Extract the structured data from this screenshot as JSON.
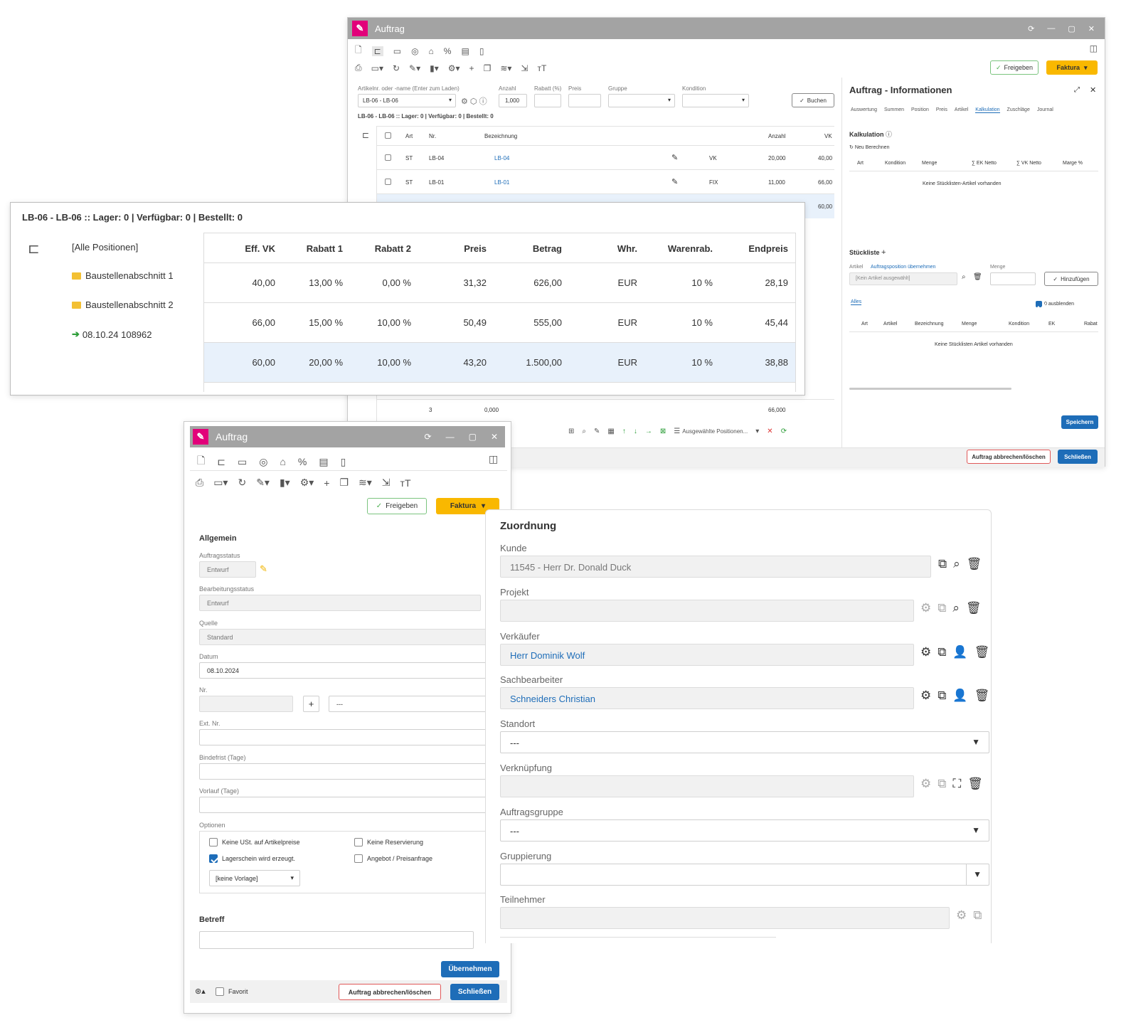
{
  "back_window": {
    "title": "Auftrag",
    "top_buttons": {
      "freigeben": "Freigeben",
      "faktura": "Faktura"
    },
    "article_field_label": "Artikelnr. oder -name (Enter zum Laden)",
    "article_value": "LB-06 - LB-06",
    "anzahl_label": "Anzahl",
    "anzahl_value": "1,000",
    "rabatt_label": "Rabatt (%)",
    "preis_label": "Preis",
    "gruppe_label": "Gruppe",
    "kondition_label": "Kondition",
    "buchen_label": "Buchen",
    "stock_line": "LB-06 - LB-06 :: Lager: 0 | Verfügbar: 0 | Bestellt: 0",
    "columns": [
      "Art",
      "Nr.",
      "Bezeichnung",
      "Anzahl",
      "VK"
    ],
    "rows": [
      {
        "art": "ST",
        "nr": "LB-04",
        "bez": "LB-04",
        "kond": "VK",
        "anzahl": "20,000",
        "vk": "40,00"
      },
      {
        "art": "ST",
        "nr": "LB-01",
        "bez": "LB-01",
        "kond": "FIX",
        "anzahl": "11,000",
        "vk": "66,00"
      },
      {
        "vk": "60,00"
      }
    ],
    "footer": {
      "count": "3",
      "anzahl": "0,000",
      "vk": "66,000"
    },
    "selected_positions": "Ausgewählte Positionen...",
    "bottom_buttons": {
      "cancel": "Auftrag abbrechen/löschen",
      "close": "Schließen"
    },
    "info_panel": {
      "title": "Auftrag - Informationen",
      "tabs": [
        "Auswertung",
        "Summen",
        "Position",
        "Preis",
        "Artikel",
        "Kalkulation",
        "Zuschläge",
        "Journal"
      ],
      "active_tab": "Kalkulation",
      "kalk_title": "Kalkulation",
      "recalc": "Neu Berechnen",
      "kalk_columns": [
        "Art",
        "Kondition",
        "Menge",
        "∑ EK Netto",
        "∑ VK Netto",
        "Marge %"
      ],
      "kalk_empty": "Keine Stücklisten-Artikel vorhanden",
      "stueckliste_title": "Stückliste",
      "artikel_label": "Artikel",
      "auftragsposition_link": "Auftragsposition übernehmen",
      "artikel_placeholder": "[Kein Artikel ausgewählt]",
      "menge_label": "Menge",
      "hinzufuegen": "Hinzufügen",
      "alles_tab": "Alles",
      "ausblenden": "0 ausblenden",
      "sl_columns": [
        "Art",
        "Artikel",
        "Bezeichnung",
        "Menge",
        "Kondition",
        "EK",
        "Rabat"
      ],
      "sl_empty": "Keine Stücklisten Artikel vorhanden",
      "speichern": "Speichern"
    }
  },
  "zoom_table": {
    "header": "LB-06 - LB-06 :: Lager: 0 | Verfügbar: 0 | Bestellt: 0",
    "tree": [
      {
        "label": "[Alle Positionen]",
        "icon": "none"
      },
      {
        "label": "Baustellenabschnitt 1",
        "icon": "folder-icon"
      },
      {
        "label": "Baustellenabschnitt 2",
        "icon": "folder-icon"
      },
      {
        "label": "08.10.24 108962",
        "icon": "arrow-right-icon"
      }
    ],
    "columns": [
      "Eff. VK",
      "Rabatt 1",
      "Rabatt 2",
      "Preis",
      "Betrag",
      "Whr.",
      "Warenrab.",
      "Endpreis"
    ],
    "rows": [
      [
        "40,00",
        "13,00 %",
        "0,00 %",
        "31,32",
        "626,00",
        "EUR",
        "10 %",
        "28,19"
      ],
      [
        "66,00",
        "15,00 %",
        "10,00 %",
        "50,49",
        "555,00",
        "EUR",
        "10 %",
        "45,44"
      ],
      [
        "60,00",
        "20,00 %",
        "10,00 %",
        "43,20",
        "1.500,00",
        "EUR",
        "10 %",
        "38,88"
      ]
    ],
    "highlight_color": "#e8f1fb"
  },
  "front_window": {
    "title": "Auftrag",
    "freigeben": "Freigeben",
    "faktura": "Faktura",
    "allgemein": "Allgemein",
    "auftragsstatus_label": "Auftragsstatus",
    "auftragsstatus_value": "Entwurf",
    "bearbeitungsstatus_label": "Bearbeitungsstatus",
    "bearbeitungsstatus_value": "Entwurf",
    "quelle_label": "Quelle",
    "quelle_value": "Standard",
    "datum_label": "Datum",
    "datum_value": "08.10.2024",
    "nr_label": "Nr.",
    "nr_suffix": "---",
    "extnr_label": "Ext. Nr.",
    "bindefrist_label": "Bindefrist (Tage)",
    "vorlauf_label": "Vorlauf (Tage)",
    "optionen_label": "Optionen",
    "options": [
      {
        "label": "Keine USt. auf Artikelpreise",
        "checked": false
      },
      {
        "label": "Keine Reservierung",
        "checked": false
      },
      {
        "label": "Lagerschein wird erzeugt.",
        "checked": true
      },
      {
        "label": "Angebot / Preisanfrage",
        "checked": false
      }
    ],
    "vorlage_value": "[keine Vorlage]",
    "betreff_label": "Betreff",
    "uebernehmen": "Übernehmen",
    "favorit": "Favorit",
    "cancel": "Auftrag abbrechen/löschen",
    "close": "Schließen"
  },
  "zuordnung": {
    "title": "Zuordnung",
    "kunde_label": "Kunde",
    "kunde_value": "11545 - Herr Dr. Donald Duck",
    "projekt_label": "Projekt",
    "verkaeufer_label": "Verkäufer",
    "verkaeufer_value": "Herr Dominik Wolf",
    "sachbearbeiter_label": "Sachbearbeiter",
    "sachbearbeiter_value": "Schneiders Christian",
    "standort_label": "Standort",
    "standort_value": "---",
    "verknuepfung_label": "Verknüpfung",
    "auftragsgruppe_label": "Auftragsgruppe",
    "auftragsgruppe_value": "---",
    "gruppierung_label": "Gruppierung",
    "teilnehmer_label": "Teilnehmer"
  },
  "colors": {
    "brand": "#e2007a",
    "accent": "#1e6db8",
    "titlebar": "#a3a3a3",
    "faktura": "#f9b800"
  }
}
